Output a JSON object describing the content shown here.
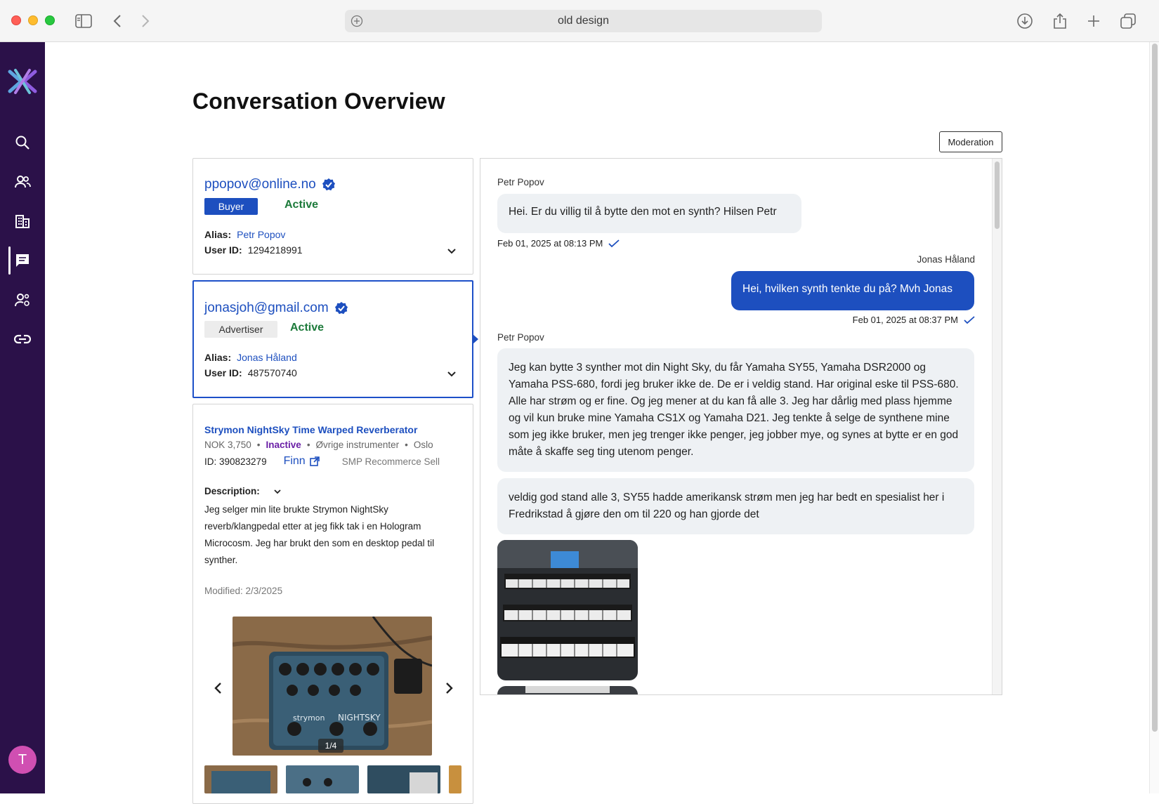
{
  "browser": {
    "url_text": "old design",
    "colors": {
      "chrome_bg": "#f5f5f5"
    }
  },
  "nav": {
    "items": [
      {
        "icon": "search-icon"
      },
      {
        "icon": "users-icon"
      },
      {
        "icon": "building-icon"
      },
      {
        "icon": "chat-icon",
        "active": true
      },
      {
        "icon": "user-settings-icon"
      },
      {
        "icon": "link-icon"
      }
    ],
    "avatar_initial": "T"
  },
  "page": {
    "title": "Conversation Overview",
    "moderation_label": "Moderation"
  },
  "buyer": {
    "email": "ppopov@online.no",
    "role": "Buyer",
    "status": "Active",
    "alias_label": "Alias:",
    "alias": "Petr Popov",
    "userid_label": "User ID:",
    "user_id": "1294218991"
  },
  "advertiser": {
    "email": "jonasjoh@gmail.com",
    "role": "Advertiser",
    "status": "Active",
    "alias_label": "Alias:",
    "alias": "Jonas Håland",
    "userid_label": "User ID:",
    "user_id": "487570740"
  },
  "listing": {
    "title": "Strymon NightSky Time Warped Reverberator",
    "price": "NOK 3,750",
    "status": "Inactive",
    "category": "Øvrige instrumenter",
    "location": "Oslo",
    "sep": "•",
    "id_text": "ID: 390823279",
    "finn_label": "Finn",
    "smp_label": "SMP Recommerce Sell",
    "description_label": "Description:",
    "description": "Jeg selger min lite brukte Strymon NightSky reverb/klangpedal etter at jeg fikk tak i en Hologram Microcosm. Jeg har brukt den som en desktop pedal til synther.",
    "modified": "Modified: 2/3/2025",
    "image_counter": "1/4"
  },
  "chat": {
    "messages": [
      {
        "sender": "Petr Popov",
        "text": "Hei. Er du villig til å bytte den mot en synth? Hilsen Petr",
        "time": "Feb 01, 2025 at 08:13 PM"
      },
      {
        "sender": "Jonas Håland",
        "text": "Hei, hvilken synth tenkte du på? Mvh Jonas",
        "time": "Feb 01, 2025 at 08:37 PM"
      },
      {
        "sender": "Petr Popov",
        "text": "Jeg kan bytte 3 synther mot din Night Sky, du får Yamaha SY55, Yamaha DSR2000 og Yamaha PSS-680, fordi jeg bruker ikke de. De er i veldig stand. Har original eske til PSS-680. Alle har strøm og er fine. Og jeg mener at du kan få alle 3. Jeg har dårlig med plass hjemme og vil kun bruke mine Yamaha CS1X og Yamaha D21. Jeg tenkte å selge de synthene mine som jeg ikke bruker, men jeg trenger ikke penger, jeg jobber mye, og synes at bytte er en god måte å skaffe seg ting utenom penger.",
        "time": ""
      },
      {
        "sender": "",
        "text": "veldig god stand alle 3, SY55 hadde amerikansk strøm men jeg har bedt en spesialist her i Fredrikstad å gjøre den om til 220 og han gjorde det",
        "time": ""
      }
    ]
  }
}
